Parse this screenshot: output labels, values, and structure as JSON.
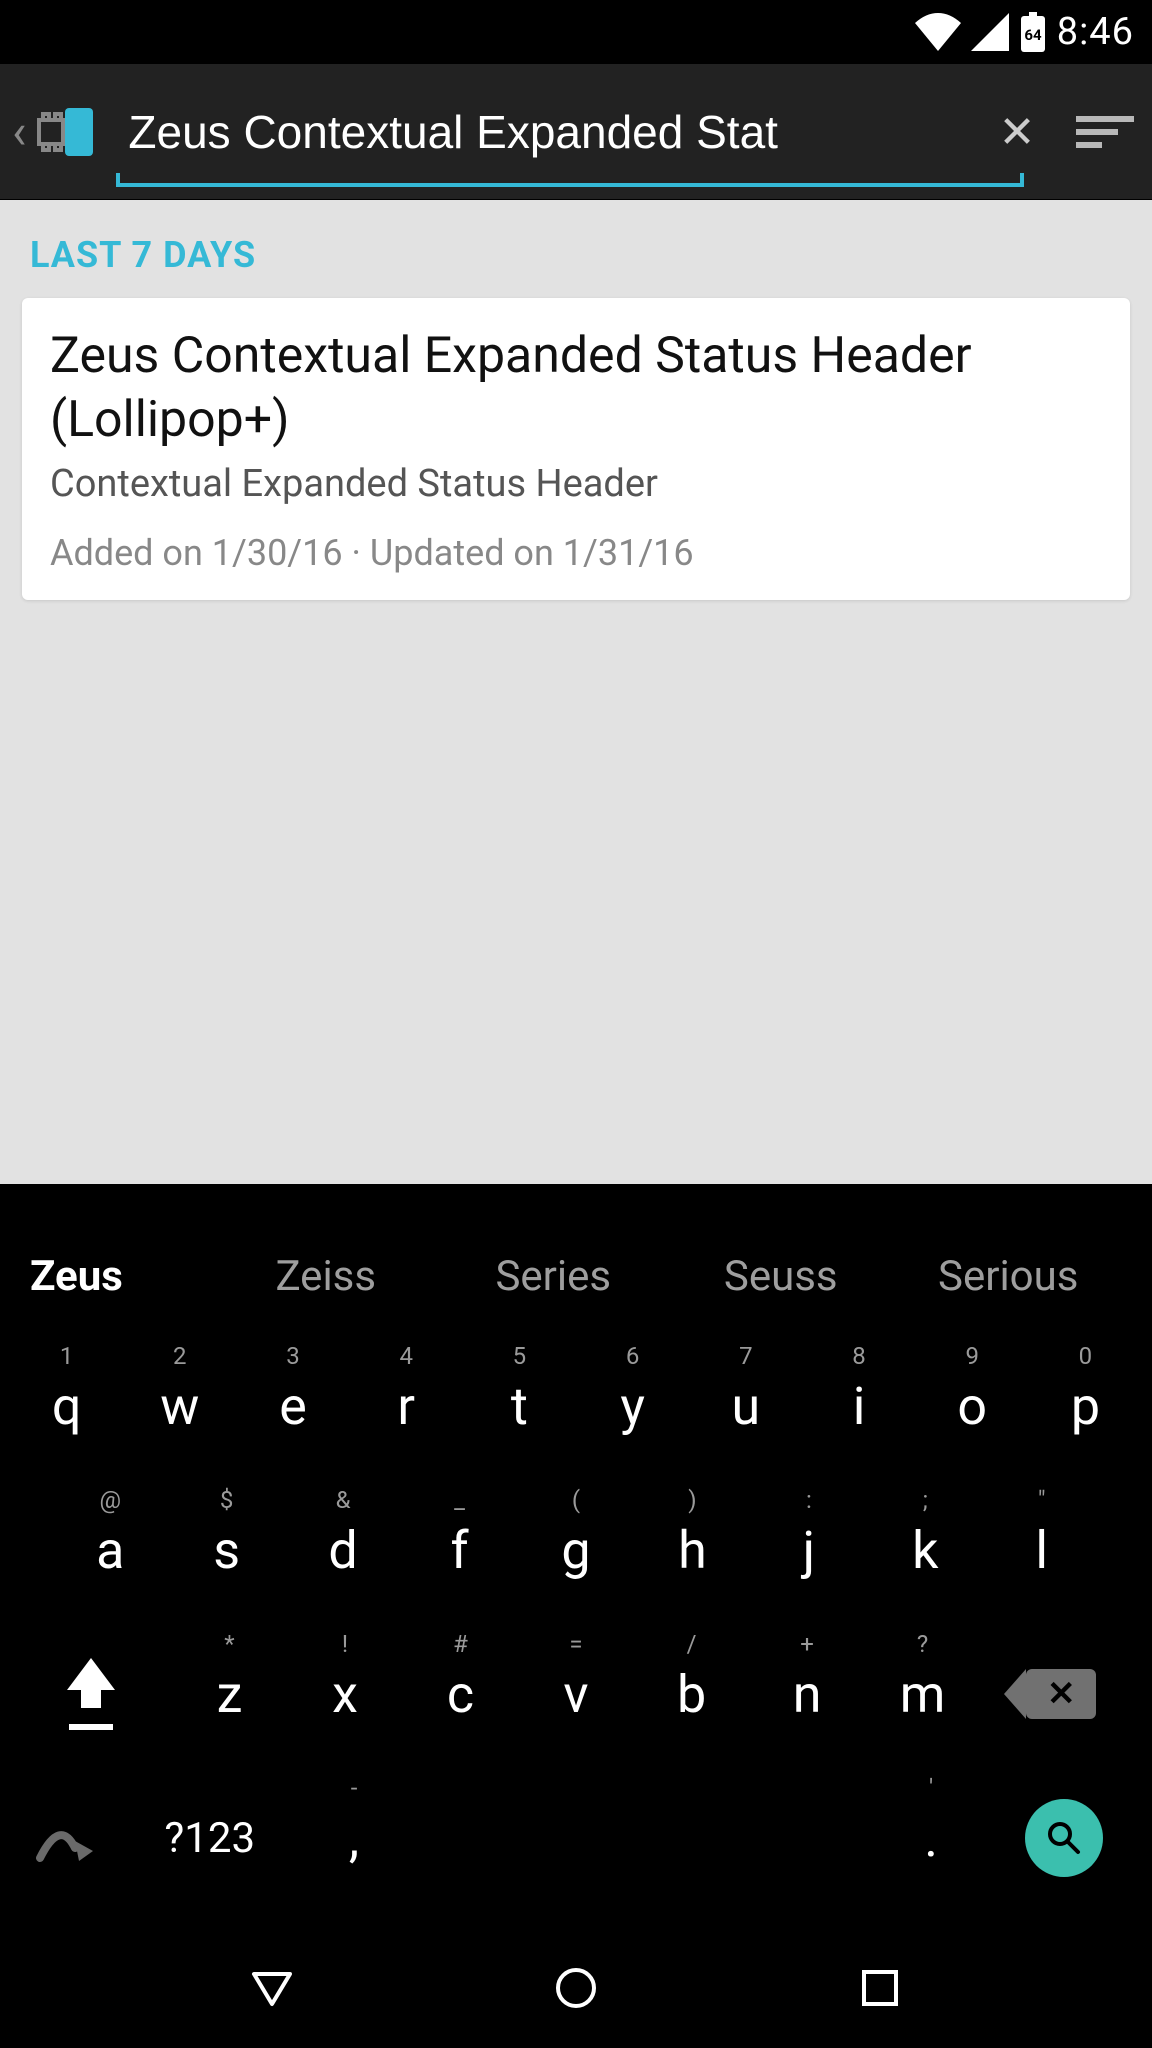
{
  "status": {
    "time": "8:46",
    "battery_label": "64"
  },
  "search": {
    "value": "Zeus Contextual Expanded Stat"
  },
  "section": {
    "label": "LAST 7 DAYS"
  },
  "result": {
    "title": "Zeus Contextual Expanded Status Header (Lollipop+)",
    "subtitle": "Contextual Expanded Status Header",
    "meta": "Added on 1/30/16 · Updated on 1/31/16"
  },
  "suggestions": [
    "Zeus",
    "Zeiss",
    "Series",
    "Seuss",
    "Serious"
  ],
  "keyboard": {
    "row1": [
      {
        "k": "q",
        "h": "1"
      },
      {
        "k": "w",
        "h": "2"
      },
      {
        "k": "e",
        "h": "3"
      },
      {
        "k": "r",
        "h": "4"
      },
      {
        "k": "t",
        "h": "5"
      },
      {
        "k": "y",
        "h": "6"
      },
      {
        "k": "u",
        "h": "7"
      },
      {
        "k": "i",
        "h": "8"
      },
      {
        "k": "o",
        "h": "9"
      },
      {
        "k": "p",
        "h": "0"
      }
    ],
    "row2": [
      {
        "k": "a",
        "h": "@"
      },
      {
        "k": "s",
        "h": "$"
      },
      {
        "k": "d",
        "h": "&"
      },
      {
        "k": "f",
        "h": "_"
      },
      {
        "k": "g",
        "h": "("
      },
      {
        "k": "h",
        "h": ")"
      },
      {
        "k": "j",
        "h": ":"
      },
      {
        "k": "k",
        "h": ";"
      },
      {
        "k": "l",
        "h": "\""
      }
    ],
    "row3": [
      {
        "k": "z",
        "h": "*"
      },
      {
        "k": "x",
        "h": "!"
      },
      {
        "k": "c",
        "h": "#"
      },
      {
        "k": "v",
        "h": "="
      },
      {
        "k": "b",
        "h": "/"
      },
      {
        "k": "n",
        "h": "+"
      },
      {
        "k": "m",
        "h": "?"
      }
    ],
    "mode": "?123",
    "comma_hint": "-",
    "period_hint": "'"
  }
}
